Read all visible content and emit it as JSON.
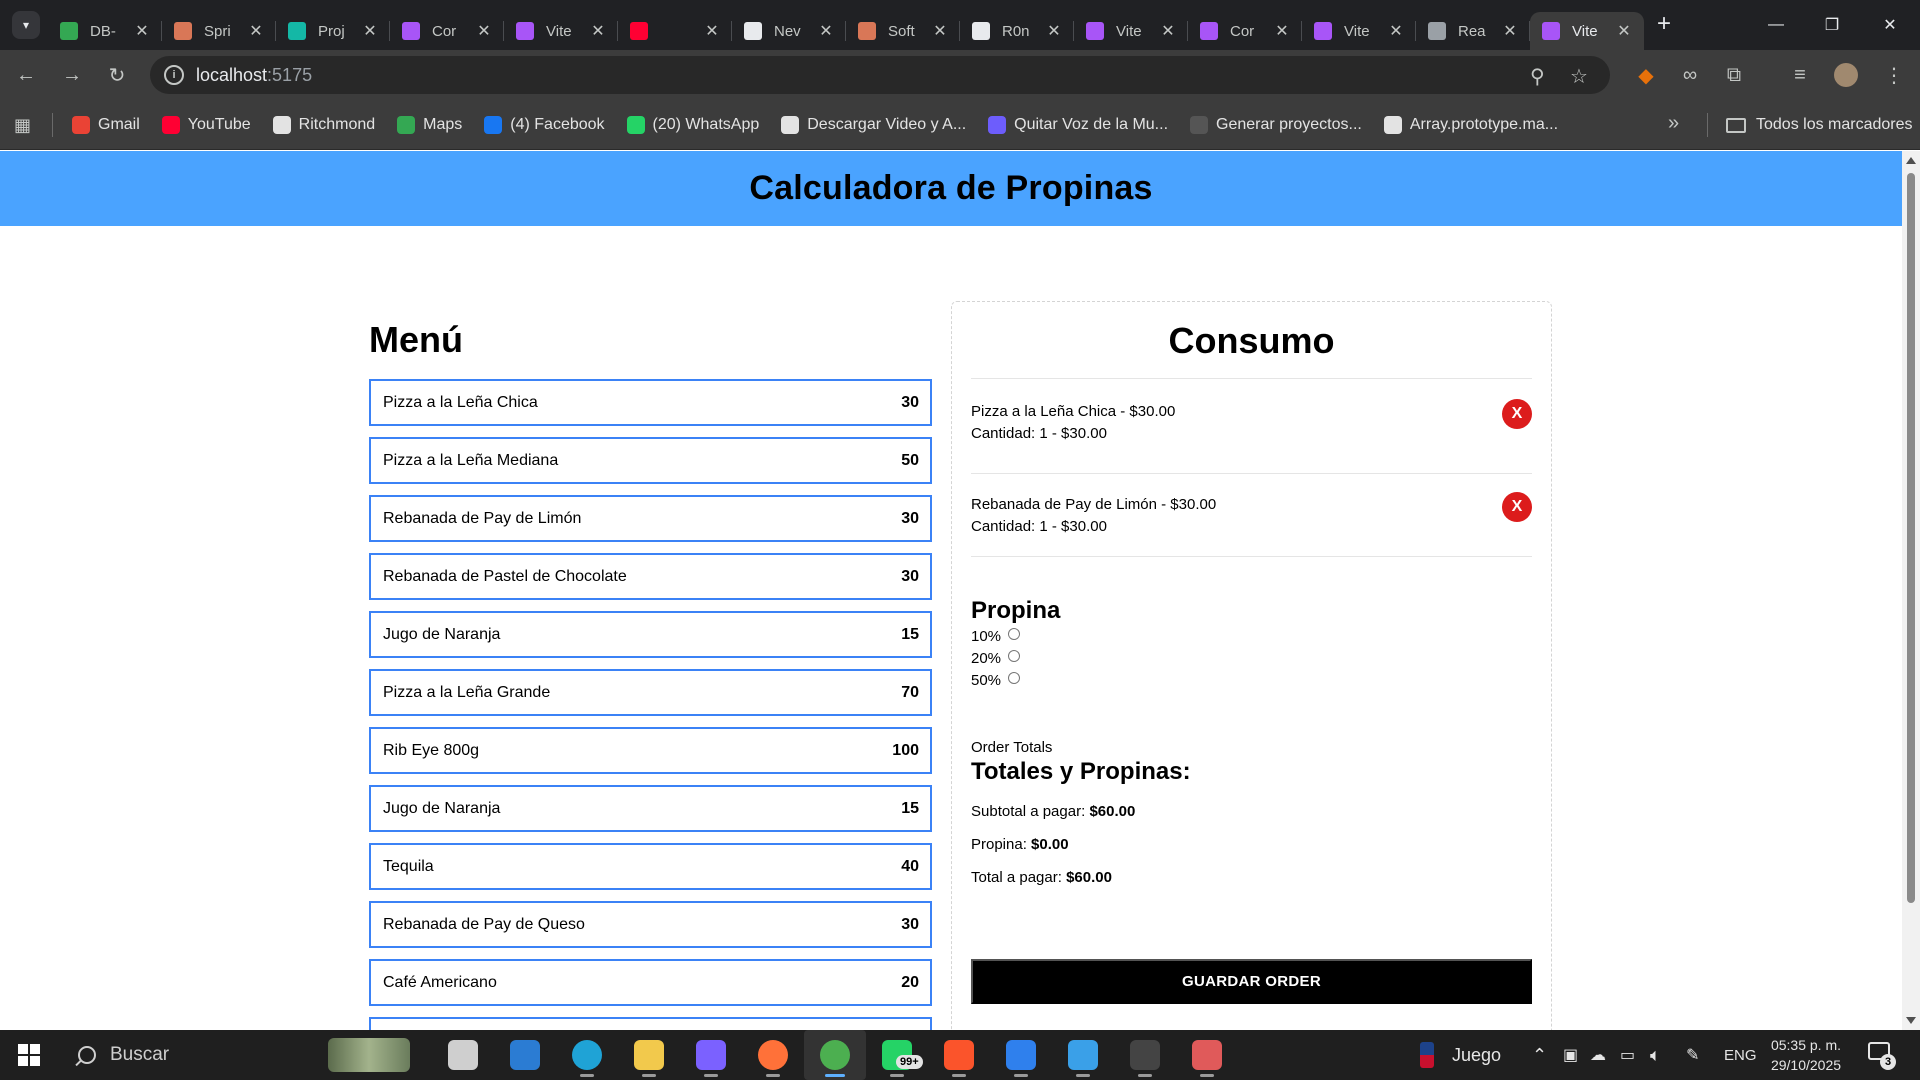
{
  "browser": {
    "tabs": [
      {
        "title": "DB-",
        "color": "#34a853"
      },
      {
        "title": "Spri",
        "color": "#d97757"
      },
      {
        "title": "Proj",
        "color": "#14b8a6"
      },
      {
        "title": "Cor",
        "color": "#a855f7"
      },
      {
        "title": "Vite",
        "color": "#a855f7"
      },
      {
        "title": "",
        "color": "#ff0033"
      },
      {
        "title": "Nev",
        "color": "#e8eaed"
      },
      {
        "title": "Soft",
        "color": "#d97757"
      },
      {
        "title": "R0n",
        "color": "#e8eaed"
      },
      {
        "title": "Vite",
        "color": "#a855f7"
      },
      {
        "title": "Cor",
        "color": "#a855f7"
      },
      {
        "title": "Vite",
        "color": "#a855f7"
      },
      {
        "title": "Rea",
        "color": "#9aa0a6"
      },
      {
        "title": "Vite",
        "color": "#a855f7",
        "active": true
      }
    ],
    "url_host": "localhost",
    "url_port": ":5175",
    "bookmarks": [
      {
        "label": "Gmail",
        "color": "#ea4335"
      },
      {
        "label": "YouTube",
        "color": "#ff0033"
      },
      {
        "label": "Ritchmond",
        "color": "#e3e3e3"
      },
      {
        "label": "Maps",
        "color": "#34a853"
      },
      {
        "label": "(4) Facebook",
        "color": "#1877f2"
      },
      {
        "label": "(20) WhatsApp",
        "color": "#25d366"
      },
      {
        "label": "Descargar Video y A...",
        "color": "#e3e3e3"
      },
      {
        "label": "Quitar Voz de la Mu...",
        "color": "#6d5dfc"
      },
      {
        "label": "Generar proyectos...",
        "color": "#555555"
      },
      {
        "label": "Array.prototype.ma...",
        "color": "#e3e3e3"
      }
    ],
    "all_bookmarks_label": "Todos los marcadores"
  },
  "app": {
    "header_title": "Calculadora de Propinas",
    "menu_title": "Menú",
    "menu_items": [
      {
        "name": "Pizza a la Leña Chica",
        "price": "30"
      },
      {
        "name": "Pizza a la Leña Mediana",
        "price": "50"
      },
      {
        "name": "Rebanada de Pay de Limón",
        "price": "30"
      },
      {
        "name": "Rebanada de Pastel de Chocolate",
        "price": "30"
      },
      {
        "name": "Jugo de Naranja",
        "price": "15"
      },
      {
        "name": "Pizza a la Leña Grande",
        "price": "70"
      },
      {
        "name": "Rib Eye 800g",
        "price": "100"
      },
      {
        "name": "Jugo de Naranja",
        "price": "15"
      },
      {
        "name": "Tequila",
        "price": "40"
      },
      {
        "name": "Rebanada de Pay de Queso",
        "price": "30"
      },
      {
        "name": "Café Americano",
        "price": "20"
      },
      {
        "name": "",
        "price": ""
      }
    ],
    "consumo_title": "Consumo",
    "order_items": [
      {
        "line1": "Pizza a la Leña Chica - $30.00",
        "line2": "Cantidad: 1 - $30.00",
        "remove": "X"
      },
      {
        "line1": "Rebanada de Pay de Limón - $30.00",
        "line2": "Cantidad: 1 - $30.00",
        "remove": "X"
      }
    ],
    "tip_title": "Propina",
    "tip_options": [
      "10%",
      "20%",
      "50%"
    ],
    "order_totals_label": "Order Totals",
    "totals_title": "Totales y Propinas:",
    "subtotal_label": "Subtotal a pagar:",
    "subtotal_value": "$60.00",
    "tip_label": "Propina:",
    "tip_value": "$0.00",
    "total_label": "Total a pagar:",
    "total_value": "$60.00",
    "save_button": "GUARDAR ORDER"
  },
  "taskbar": {
    "search_placeholder": "Buscar",
    "whatsapp_badge": "99+",
    "weather_label": "Juego",
    "language": "ENG",
    "time": "05:35 p. m.",
    "date": "29/10/2025",
    "notification_count": "3",
    "apps": [
      {
        "name": "task-view",
        "color": "#cfcfcf"
      },
      {
        "name": "mail",
        "color": "#2b7cd3"
      },
      {
        "name": "edge",
        "color": "#1fa3d6"
      },
      {
        "name": "file-explorer",
        "color": "#f2c94c"
      },
      {
        "name": "m365",
        "color": "#7b61ff"
      },
      {
        "name": "firefox",
        "color": "#ff7139"
      },
      {
        "name": "chrome",
        "color": "#4caf50"
      },
      {
        "name": "whatsapp",
        "color": "#25d366"
      },
      {
        "name": "brave",
        "color": "#fb542b"
      },
      {
        "name": "vscode",
        "color": "#2f80ed"
      },
      {
        "name": "azure-data-studio",
        "color": "#3aa0e8"
      },
      {
        "name": "terminal",
        "color": "#444444"
      },
      {
        "name": "snipping-tool",
        "color": "#e05a5a"
      }
    ]
  }
}
